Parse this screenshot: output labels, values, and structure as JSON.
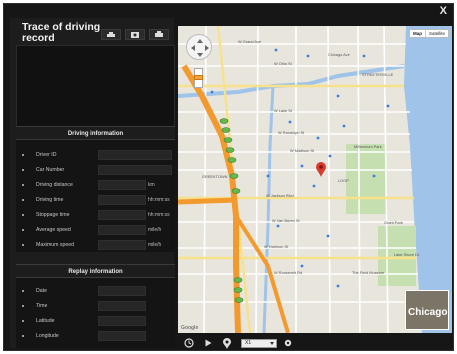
{
  "window": {
    "title": "Trace of driving record",
    "close_label": "X"
  },
  "driving_info": {
    "header": "Driving information",
    "rows": [
      {
        "label": "Driver ID",
        "unit": ""
      },
      {
        "label": "Car Number",
        "unit": ""
      },
      {
        "label": "Driving distance",
        "unit": "km"
      },
      {
        "label": "Driving time",
        "unit": "hh:mm:ss"
      },
      {
        "label": "Stoppage time",
        "unit": "hh:mm:ss"
      },
      {
        "label": "Average speed",
        "unit": "mile/h"
      },
      {
        "label": "Maximum speed",
        "unit": "mile/h"
      }
    ]
  },
  "replay_info": {
    "header": "Replay information",
    "rows": [
      {
        "label": "Date"
      },
      {
        "label": "Time"
      },
      {
        "label": "Latitude"
      },
      {
        "label": "Longitude"
      }
    ]
  },
  "map": {
    "type_buttons": [
      "Map",
      "Satellite"
    ],
    "inset_label": "Chicago",
    "google_label": "Google",
    "labels": {
      "w_grand_ave": "W Grand Ave",
      "w_ohio": "W Ohio St",
      "w_lake": "W Lake St",
      "w_randolph": "W Randolph St",
      "w_madison": "W Madison St",
      "w_jackson": "W Jackson Blvd",
      "w_van_buren": "W Van Buren St",
      "w_harrison": "W Harrison St",
      "w_roosevelt": "W Roosevelt Rd",
      "greektown": "GREEKTOWN",
      "loop": "LOOP",
      "millennium": "Millennium Park",
      "chicago_ave": "Chicago Ave",
      "streeterville": "STREETERVILLE",
      "grant_park": "Grant Park",
      "field_museum": "The Field Museum",
      "lake_shore": "Lake Shore Dr"
    },
    "icons": [
      "pan-control",
      "zoom-slider",
      "map-marker"
    ]
  },
  "playback": {
    "speed_value": "X1",
    "icons": [
      "clock-icon",
      "play-icon",
      "location-icon",
      "settings-icon"
    ]
  }
}
